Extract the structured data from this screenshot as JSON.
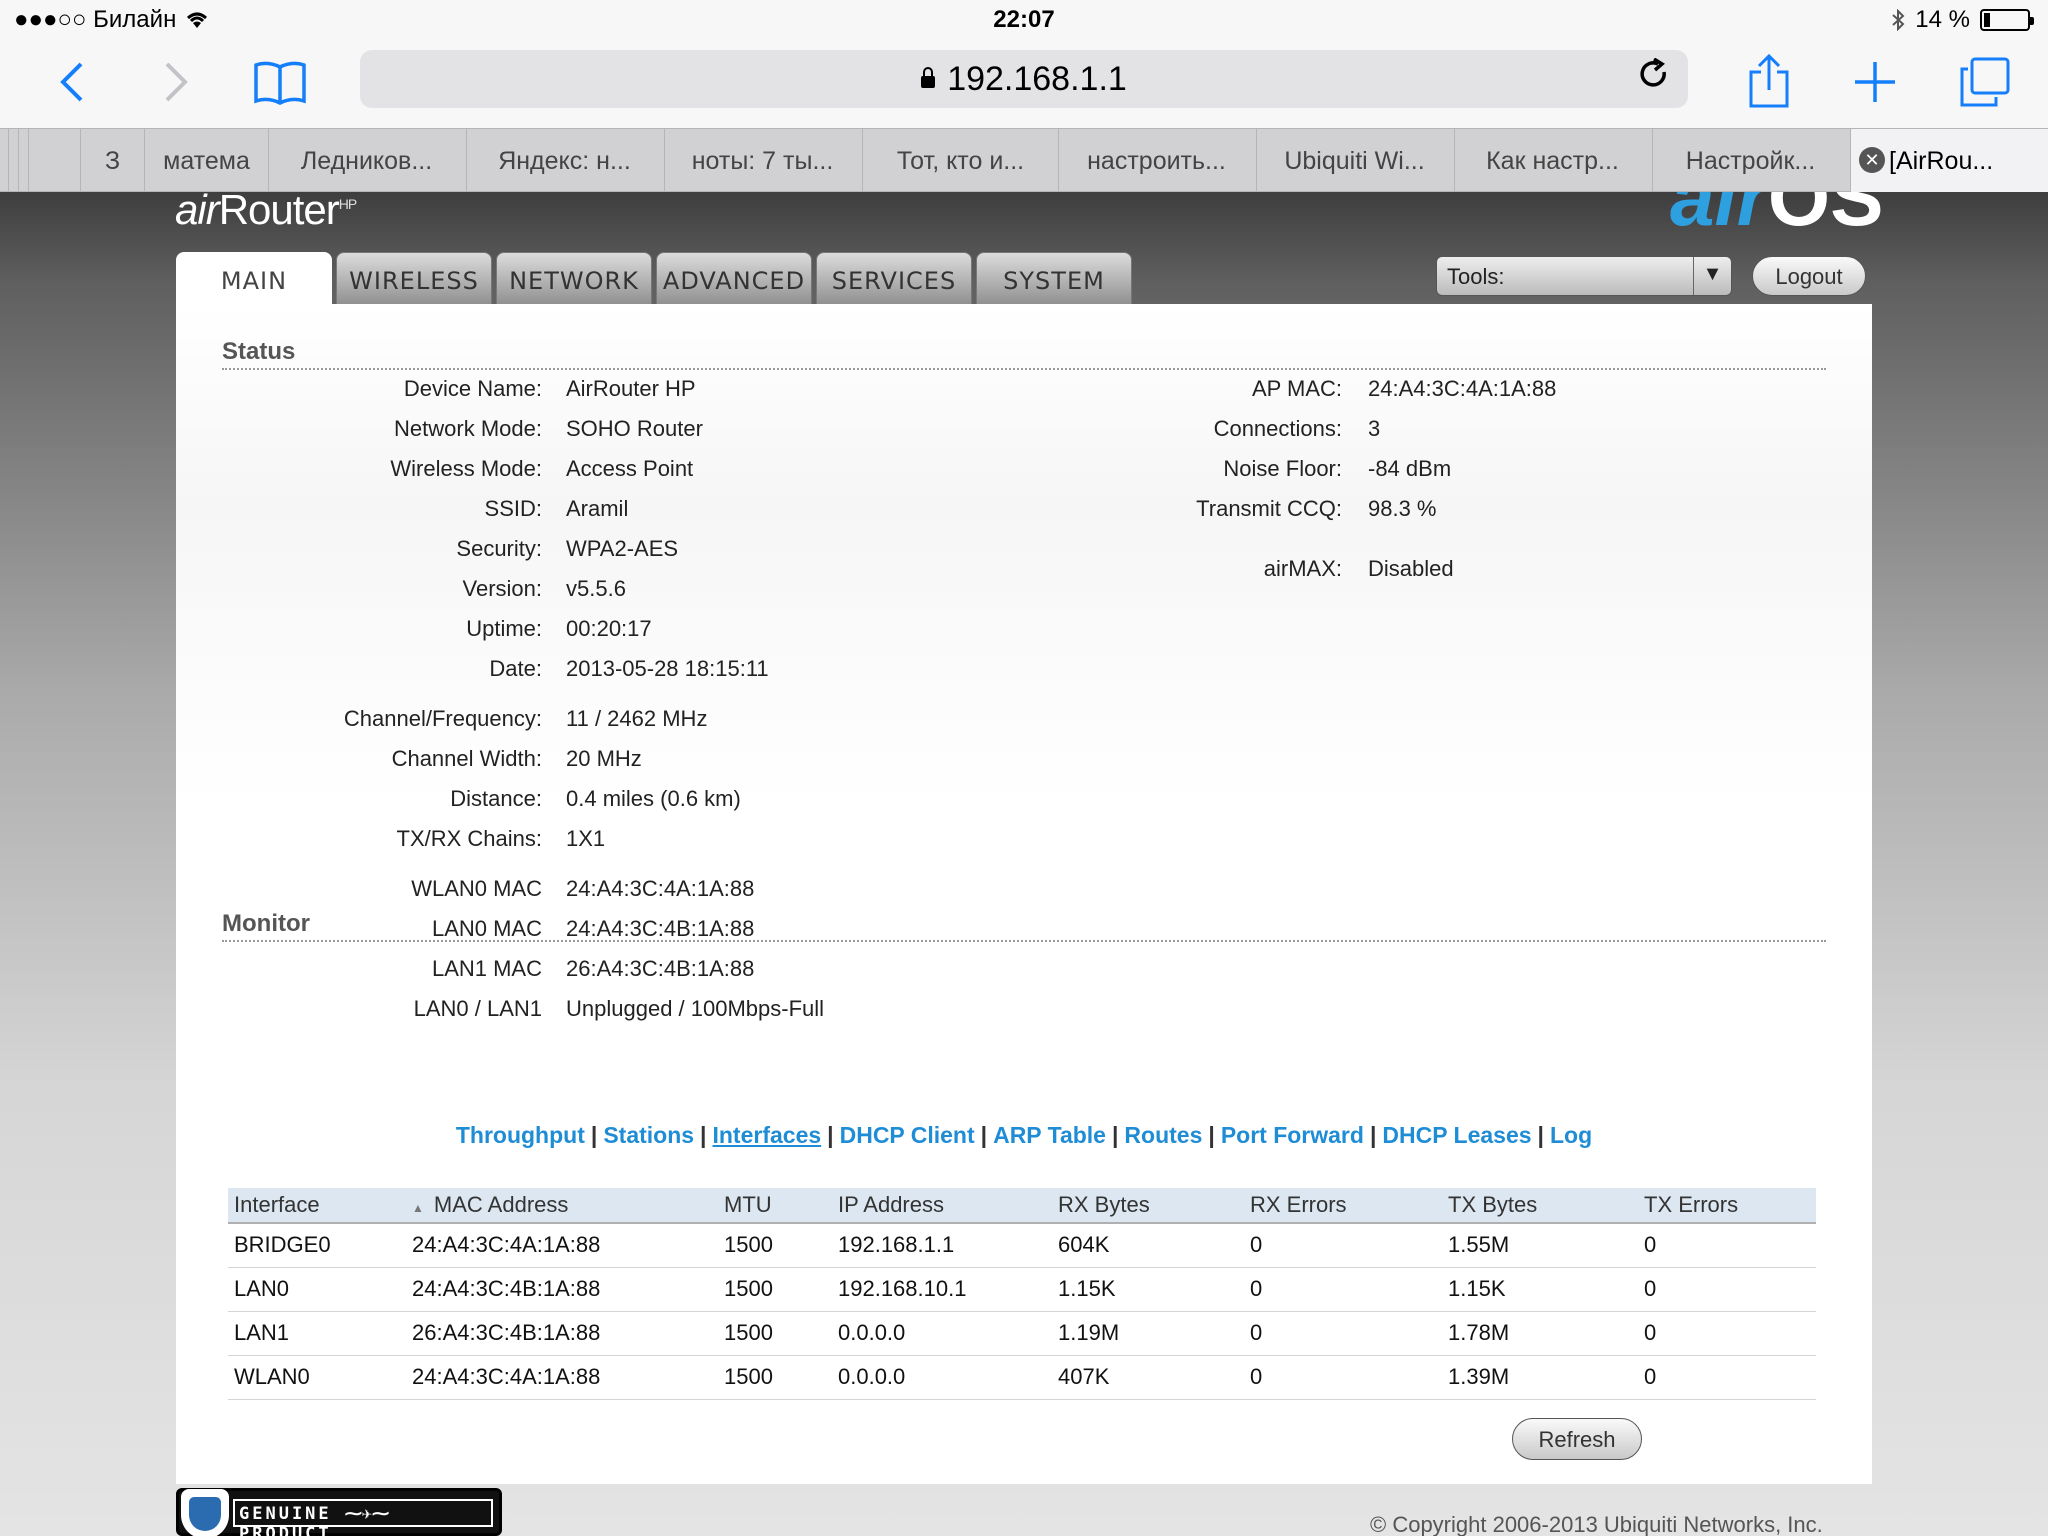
{
  "statusbar": {
    "carrier": "●●●○○ Билайн",
    "wifi_icon": "wifi-icon",
    "time": "22:07",
    "bluetooth_icon": "bluetooth-icon",
    "battery": "14 %",
    "battery_level": 0.14
  },
  "browser": {
    "url": "192.168.1.1",
    "tabs": [
      {
        "label": "З"
      },
      {
        "label": "матема"
      },
      {
        "label": "Ледников..."
      },
      {
        "label": "Яндекс: н..."
      },
      {
        "label": "ноты: 7 ты..."
      },
      {
        "label": "Тот, кто и..."
      },
      {
        "label": "настроить..."
      },
      {
        "label": "Ubiquiti Wi..."
      },
      {
        "label": "Как настр..."
      },
      {
        "label": "Настройк..."
      },
      {
        "label": "[AirRou..."
      }
    ]
  },
  "header": {
    "logo_air": "air",
    "logo_router": "Router",
    "logo_hp": "HP",
    "os_air": "air",
    "os_os": "OS"
  },
  "nav": {
    "tabs": [
      "MAIN",
      "WIRELESS",
      "NETWORK",
      "ADVANCED",
      "SERVICES",
      "SYSTEM"
    ],
    "tools_label": "Tools:",
    "logout_label": "Logout"
  },
  "status": {
    "title": "Status",
    "left": [
      {
        "label": "Device Name:",
        "value": "AirRouter HP"
      },
      {
        "label": "Network Mode:",
        "value": "SOHO Router"
      },
      {
        "label": "Wireless Mode:",
        "value": "Access Point"
      },
      {
        "label": "SSID:",
        "value": "Aramil"
      },
      {
        "label": "Security:",
        "value": "WPA2-AES"
      },
      {
        "label": "Version:",
        "value": "v5.5.6"
      },
      {
        "label": "Uptime:",
        "value": "00:20:17"
      },
      {
        "label": "Date:",
        "value": "2013-05-28 18:15:11"
      },
      {
        "label": "Channel/Frequency:",
        "value": "11 / 2462 MHz"
      },
      {
        "label": "Channel Width:",
        "value": "20 MHz"
      },
      {
        "label": "Distance:",
        "value": "0.4 miles (0.6 km)"
      },
      {
        "label": "TX/RX Chains:",
        "value": "1X1"
      },
      {
        "label": "WLAN0 MAC",
        "value": "24:A4:3C:4A:1A:88"
      },
      {
        "label": "LAN0 MAC",
        "value": "24:A4:3C:4B:1A:88"
      },
      {
        "label": "LAN1 MAC",
        "value": "26:A4:3C:4B:1A:88"
      },
      {
        "label": "LAN0 / LAN1",
        "value": "Unplugged / 100Mbps-Full"
      }
    ],
    "right": [
      {
        "label": "AP MAC:",
        "value": "24:A4:3C:4A:1A:88"
      },
      {
        "label": "Connections:",
        "value": "3"
      },
      {
        "label": "Noise Floor:",
        "value": "-84 dBm"
      },
      {
        "label": "Transmit CCQ:",
        "value": "98.3 %"
      },
      {
        "label": "airMAX:",
        "value": "Disabled"
      }
    ]
  },
  "monitor": {
    "title": "Monitor",
    "links": [
      "Throughput",
      "Stations",
      "Interfaces",
      "DHCP Client",
      "ARP Table",
      "Routes",
      "Port Forward",
      "DHCP Leases",
      "Log"
    ],
    "selected": "Interfaces",
    "table": {
      "headers": [
        "Interface",
        "MAC Address",
        "MTU",
        "IP Address",
        "RX Bytes",
        "RX Errors",
        "TX Bytes",
        "TX Errors"
      ],
      "rows": [
        [
          "BRIDGE0",
          "24:A4:3C:4A:1A:88",
          "1500",
          "192.168.1.1",
          "604K",
          "0",
          "1.55M",
          "0"
        ],
        [
          "LAN0",
          "24:A4:3C:4B:1A:88",
          "1500",
          "192.168.10.1",
          "1.15K",
          "0",
          "1.15K",
          "0"
        ],
        [
          "LAN1",
          "26:A4:3C:4B:1A:88",
          "1500",
          "0.0.0.0",
          "1.19M",
          "0",
          "1.78M",
          "0"
        ],
        [
          "WLAN0",
          "24:A4:3C:4A:1A:88",
          "1500",
          "0.0.0.0",
          "407K",
          "0",
          "1.39M",
          "0"
        ]
      ]
    },
    "refresh_label": "Refresh"
  },
  "footer": {
    "badge_left": "GENUINE",
    "badge_right": "PRODUCT",
    "copyright": "© Copyright 2006-2013 Ubiquiti Networks, Inc."
  }
}
